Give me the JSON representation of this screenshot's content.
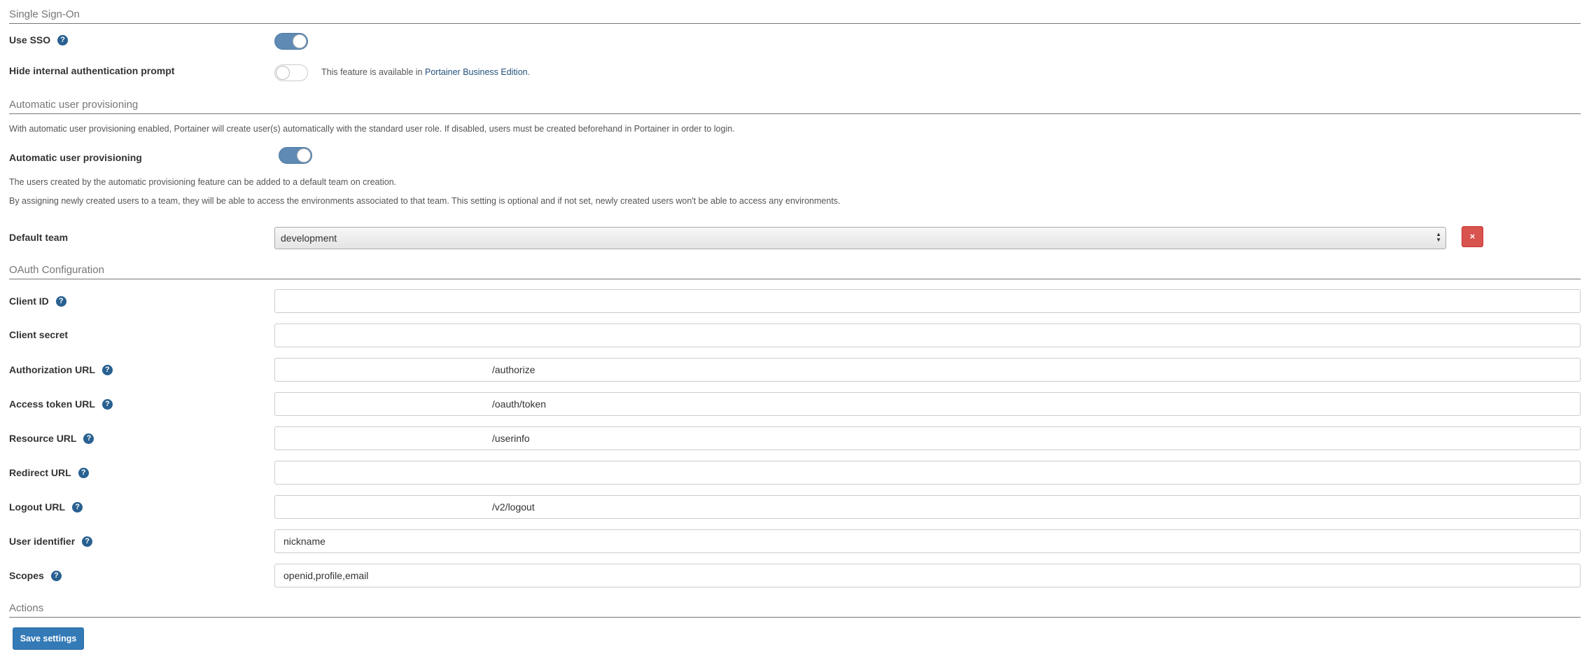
{
  "sso": {
    "section_title": "Single Sign-On",
    "use_sso_label": "Use SSO",
    "use_sso_enabled": true,
    "hide_prompt_label": "Hide internal authentication prompt",
    "hide_prompt_enabled": false,
    "be_note_prefix": "This feature is available in ",
    "be_note_link": "Portainer Business Edition",
    "be_note_suffix": "."
  },
  "provisioning": {
    "section_title": "Automatic user provisioning",
    "description": "With automatic user provisioning enabled, Portainer will create user(s) automatically with the standard user role. If disabled, users must be created beforehand in Portainer in order to login.",
    "label": "Automatic user provisioning",
    "enabled": true,
    "team_note_1": "The users created by the automatic provisioning feature can be added to a default team on creation.",
    "team_note_2": "By assigning newly created users to a team, they will be able to access the environments associated to that team. This setting is optional and if not set, newly created users won't be able to access any environments.",
    "default_team_label": "Default team",
    "default_team_value": "development",
    "remove_button": "×"
  },
  "oauth": {
    "section_title": "OAuth Configuration",
    "fields": {
      "client_id": {
        "label": "Client ID",
        "value": ""
      },
      "client_secret": {
        "label": "Client secret",
        "value": ""
      },
      "authorization_url": {
        "label": "Authorization URL",
        "value": "/authorize"
      },
      "access_token_url": {
        "label": "Access token URL",
        "value": "/oauth/token"
      },
      "resource_url": {
        "label": "Resource URL",
        "value": "/userinfo"
      },
      "redirect_url": {
        "label": "Redirect URL",
        "value": ""
      },
      "logout_url": {
        "label": "Logout URL",
        "value": "/v2/logout"
      },
      "user_identifier": {
        "label": "User identifier",
        "value": "nickname"
      },
      "scopes": {
        "label": "Scopes",
        "value": "openid,profile,email"
      }
    }
  },
  "actions": {
    "section_title": "Actions",
    "save_button": "Save settings"
  },
  "icons": {
    "help": "question-circle-icon",
    "remove": "times-icon"
  },
  "colors": {
    "primary": "#337ab7",
    "danger": "#d9534f",
    "toggle_on": "#5e8ab4",
    "link": "#23527c"
  }
}
